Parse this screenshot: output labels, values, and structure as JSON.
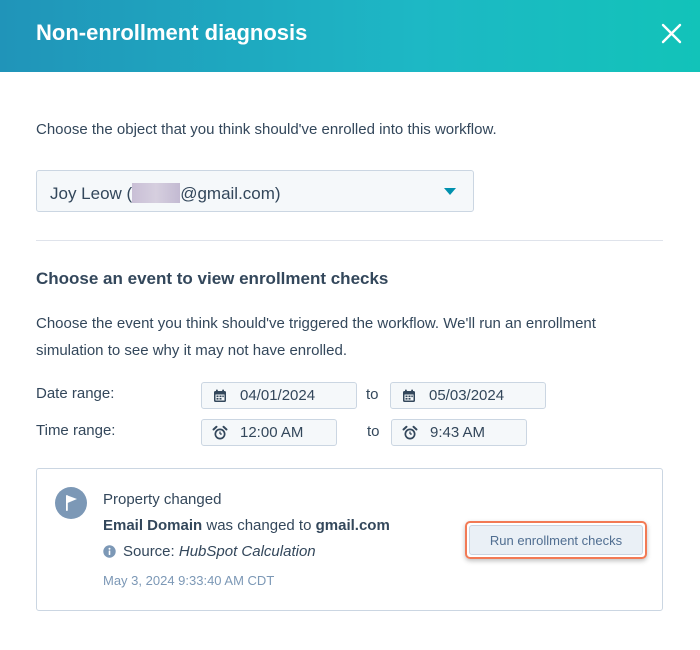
{
  "dialog": {
    "title": "Non-enrollment diagnosis",
    "close_icon": "close-icon"
  },
  "object_picker": {
    "instructions": "Choose the object that you think should've enrolled into this workflow.",
    "selected_name": "Joy Leow (",
    "selected_email_suffix": "@gmail.com)",
    "caret_icon": "caret-down-icon"
  },
  "events": {
    "heading": "Choose an event to view enrollment checks",
    "description": "Choose the event you think should've triggered the workflow. We'll run an enrollment simulation to see why it may not have enrolled.",
    "date_range": {
      "label": "Date range:",
      "start": "04/01/2024",
      "separator": "to",
      "end": "05/03/2024",
      "icon": "calendar-icon"
    },
    "time_range": {
      "label": "Time range:",
      "start": "12:00 AM",
      "separator": "to",
      "end": "9:43 AM",
      "icon": "alarm-clock-icon"
    }
  },
  "event_card": {
    "icon": "flag-icon",
    "type": "Property changed",
    "property": "Email Domain",
    "changed_text": " was changed to ",
    "new_value": "gmail.com",
    "source_label": "Source: ",
    "source_value": "HubSpot Calculation",
    "timestamp": "May 3, 2024 9:33:40 AM CDT",
    "run_button_label": "Run enrollment checks"
  },
  "colors": {
    "header_gradient_start": "#2094b9",
    "header_gradient_end": "#12c3b9",
    "highlight_border": "#f27a55",
    "text_primary": "#33475b",
    "link_teal": "#0091ae"
  }
}
